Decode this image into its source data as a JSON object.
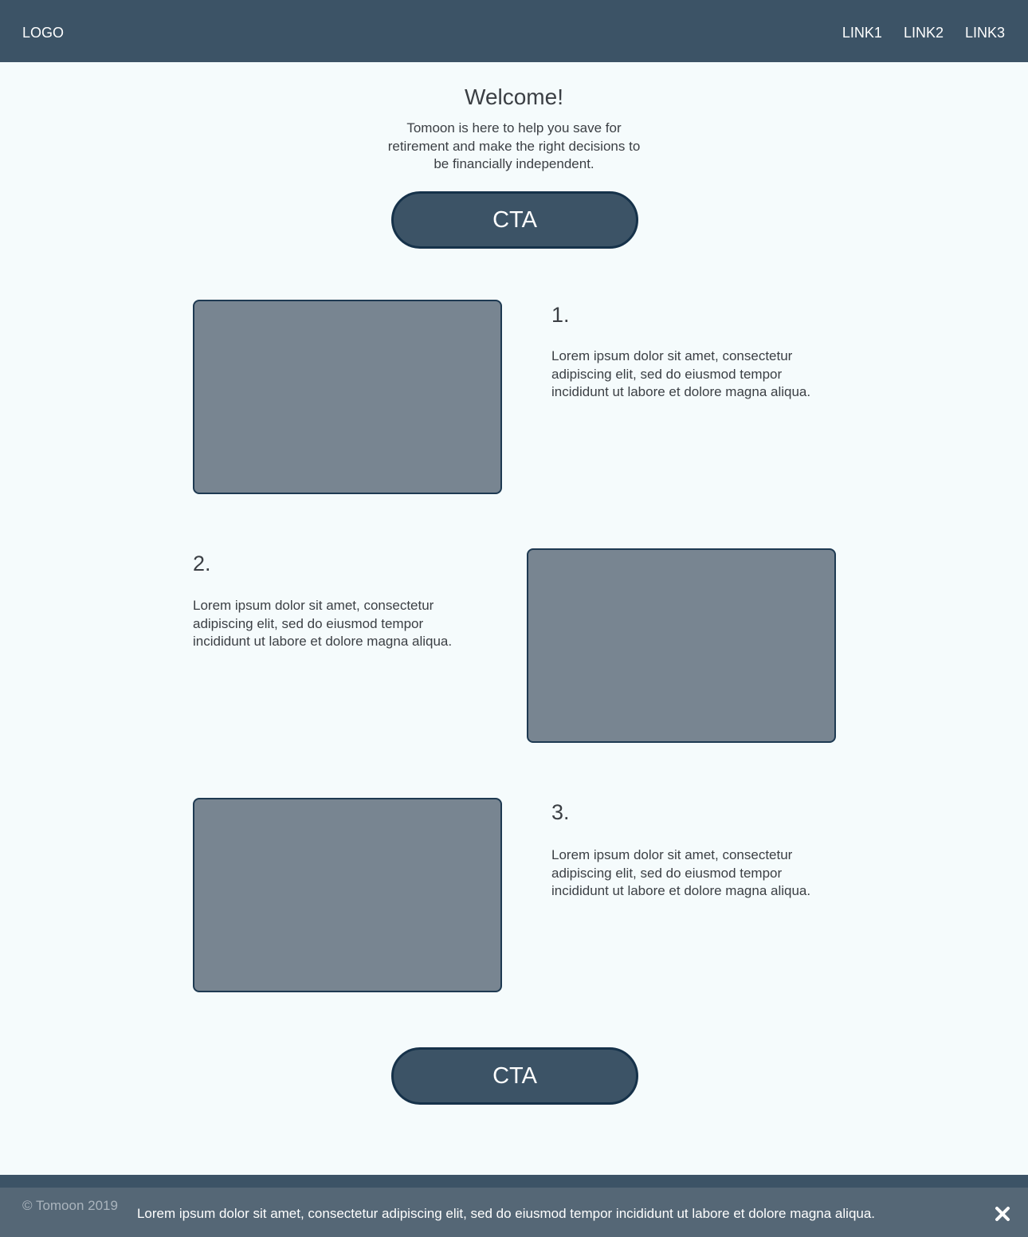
{
  "header": {
    "logo": "LOGO",
    "links": [
      "LINK1",
      "LINK2",
      "LINK3"
    ]
  },
  "hero": {
    "title": "Welcome!",
    "text_lines": [
      "Tomoon is here to help you save for",
      "retirement and make the right decisions to",
      "be financially independent."
    ],
    "cta_label": "CTA"
  },
  "steps": [
    {
      "number": "1.",
      "text_lines": [
        "Lorem ipsum dolor sit amet, consectetur",
        "adipiscing elit, sed do eiusmod tempor",
        "incididunt ut labore et dolore magna aliqua."
      ]
    },
    {
      "number": "2.",
      "text_lines": [
        "Lorem ipsum dolor sit amet, consectetur",
        "adipiscing elit, sed do eiusmod tempor",
        "incididunt ut labore et dolore magna aliqua."
      ]
    },
    {
      "number": "3.",
      "text_lines": [
        "Lorem ipsum dolor sit amet, consectetur",
        "adipiscing elit, sed do eiusmod tempor",
        "incididunt ut labore et dolore magna aliqua."
      ]
    }
  ],
  "bottom_cta_label": "CTA",
  "footer": {
    "copyright": "© Tomoon 2019"
  },
  "cookie_banner": {
    "text": "Lorem ipsum dolor sit amet, consectetur adipiscing elit, sed do eiusmod tempor incididunt ut labore et dolore magna aliqua.",
    "close_icon": "close-icon"
  },
  "colors": {
    "primary": "#3c5366",
    "border_dark": "#16324a",
    "placeholder": "#788591",
    "background": "#f5fbfc",
    "text": "#3b3f44"
  }
}
